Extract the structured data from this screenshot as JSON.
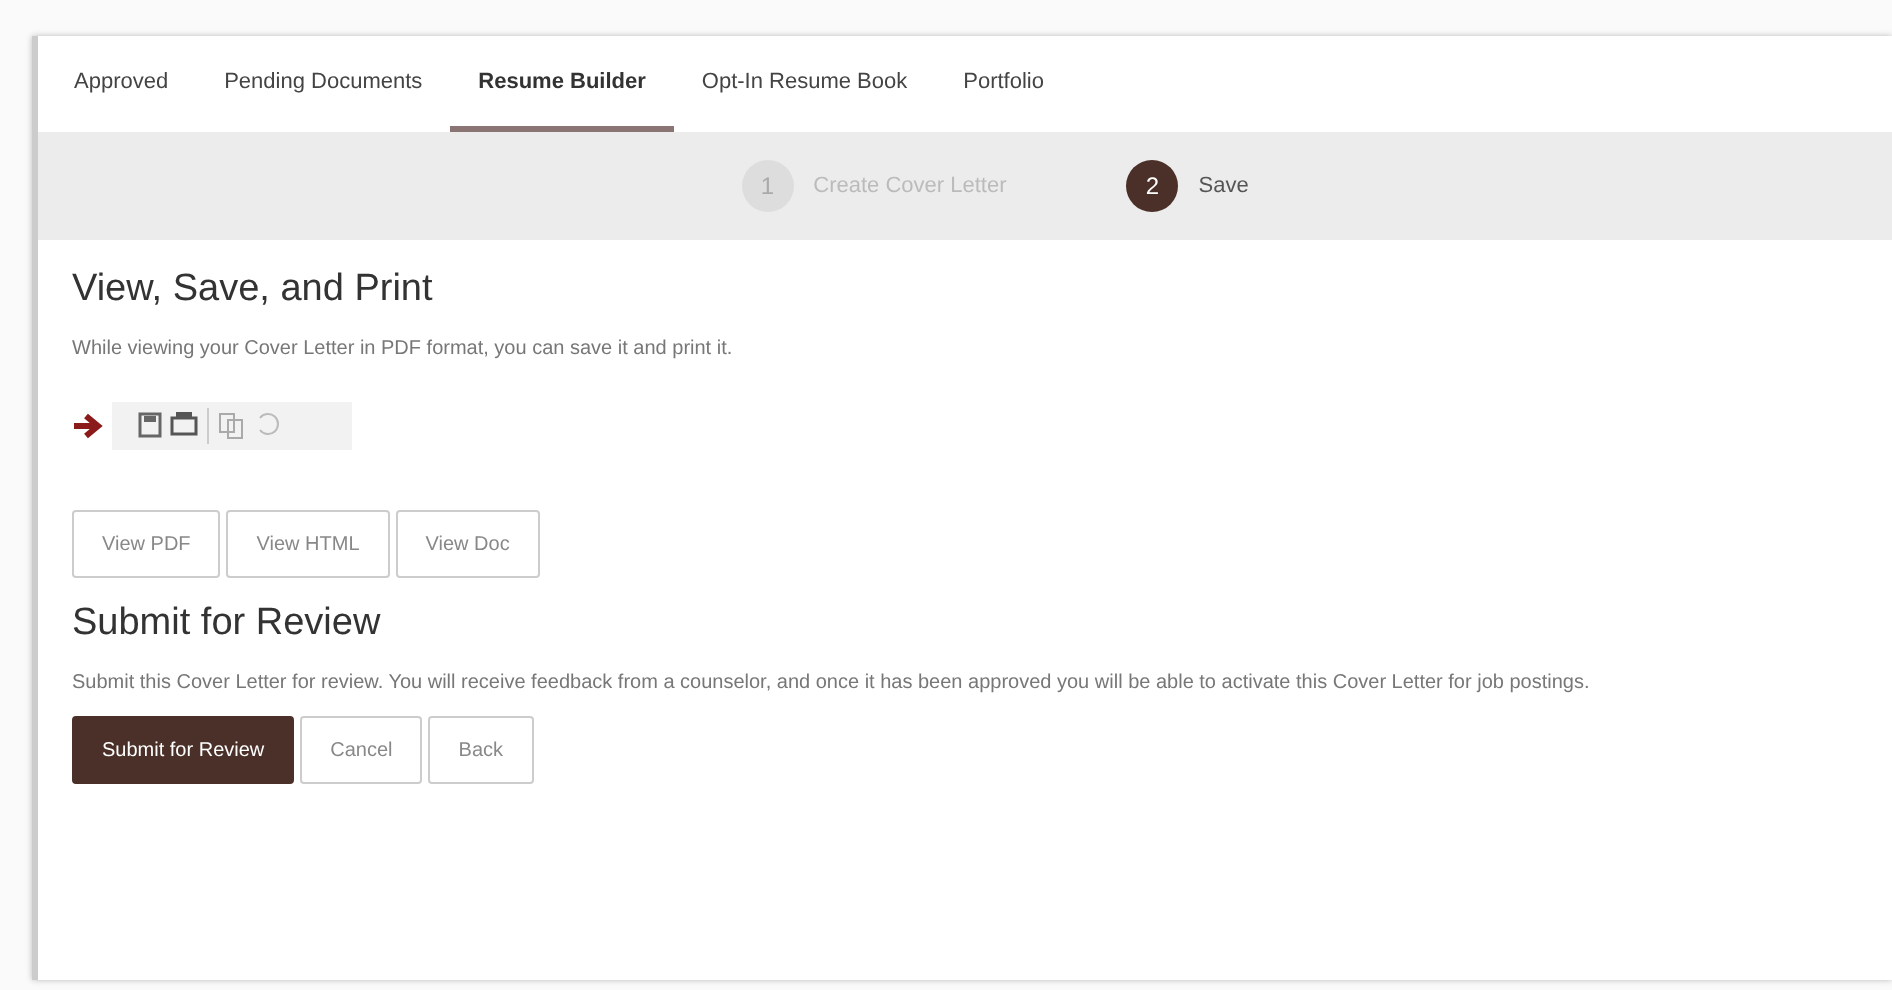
{
  "tabs": [
    {
      "label": "Approved",
      "selected": false
    },
    {
      "label": "Pending Documents",
      "selected": false
    },
    {
      "label": "Resume Builder",
      "selected": true
    },
    {
      "label": "Opt-In Resume Book",
      "selected": false
    },
    {
      "label": "Portfolio",
      "selected": false
    }
  ],
  "steps": [
    {
      "number": "1",
      "label": "Create Cover Letter",
      "selected": false
    },
    {
      "number": "2",
      "label": "Save",
      "selected": true
    }
  ],
  "view_section": {
    "title": "View, Save, and Print",
    "text": "While viewing your Cover Letter in PDF format, you can save it and print it.",
    "buttons": [
      "View PDF",
      "View HTML",
      "View Doc"
    ]
  },
  "submit_section": {
    "title": "Submit for Review",
    "text": "Submit this Cover Letter for review. You will receive feedback from a counselor, and once it has been approved you will be able to activate this Cover Letter for job postings.",
    "buttons": [
      {
        "label": "Submit for Review",
        "kind": "primary"
      },
      {
        "label": "Cancel",
        "kind": "default"
      },
      {
        "label": "Back",
        "kind": "default"
      }
    ]
  }
}
